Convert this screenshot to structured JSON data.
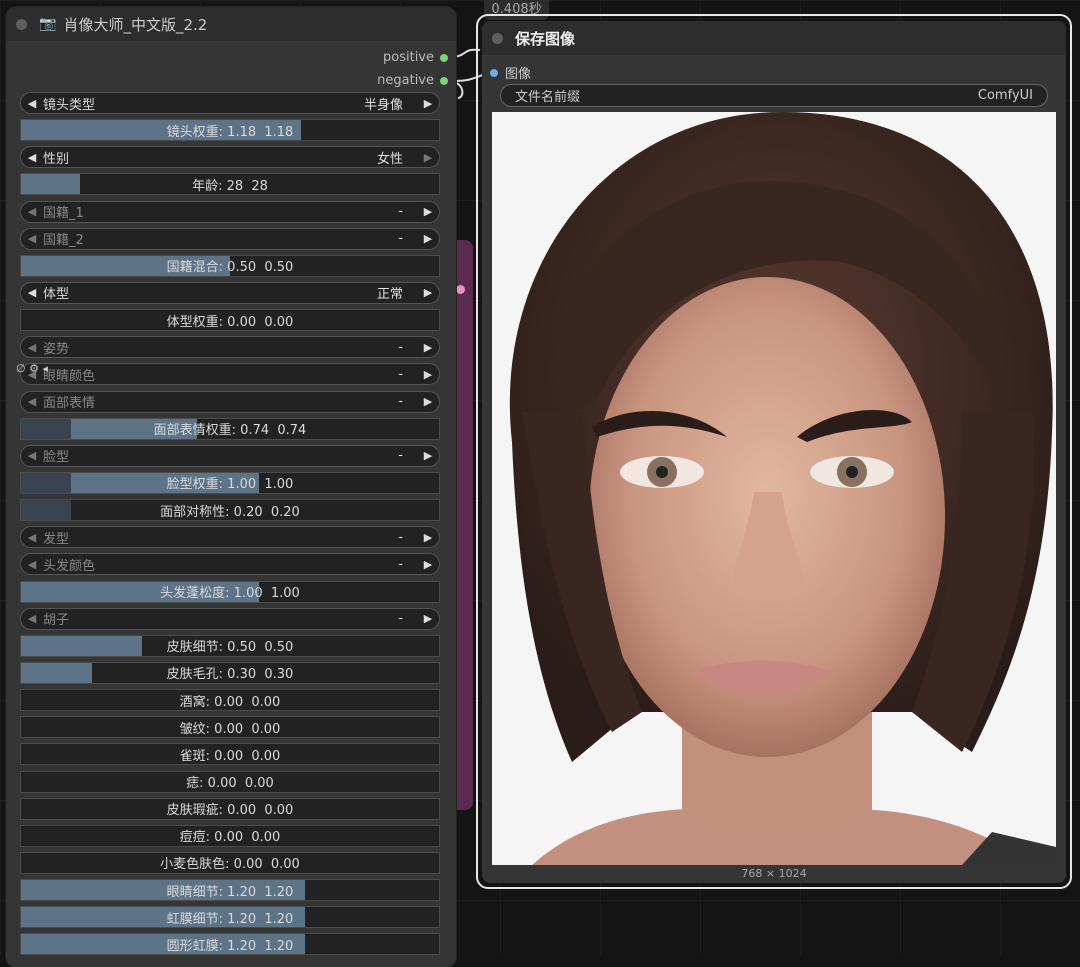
{
  "left_node": {
    "title": "肖像大师_中文版_2.2",
    "outputs": [
      "positive",
      "negative"
    ],
    "widgets": [
      {
        "kind": "combo",
        "label": "镜头类型",
        "value": "半身像",
        "dim": false
      },
      {
        "kind": "slider",
        "text": "镜头权重: 1.18  1.18",
        "fill": 0.67
      },
      {
        "kind": "combo",
        "label": "性别",
        "value": "女性",
        "dim": false,
        "rightDim": true
      },
      {
        "kind": "slider",
        "text": "年龄: 28  28",
        "fill": 0.14
      },
      {
        "kind": "combo",
        "label": "国籍_1",
        "value": "-",
        "dim": true
      },
      {
        "kind": "combo",
        "label": "国籍_2",
        "value": "-",
        "dim": true
      },
      {
        "kind": "slider",
        "text": "国籍混合: 0.50  0.50",
        "fill": 0.5
      },
      {
        "kind": "combo",
        "label": "体型",
        "value": "正常",
        "dim": false
      },
      {
        "kind": "slider",
        "text": "体型权重: 0.00  0.00",
        "fill": 0.0
      },
      {
        "kind": "combo",
        "label": "姿势",
        "value": "-",
        "dim": true
      },
      {
        "kind": "combo",
        "label": "眼睛颜色",
        "value": "-",
        "dim": true
      },
      {
        "kind": "combo",
        "label": "面部表情",
        "value": "-",
        "dim": true
      },
      {
        "kind": "slider",
        "text": "面部表情权重: 0.74  0.74",
        "fill": 0.42,
        "fill2": 0.12
      },
      {
        "kind": "combo",
        "label": "脸型",
        "value": "-",
        "dim": true
      },
      {
        "kind": "slider",
        "text": "脸型权重: 1.00  1.00",
        "fill": 0.57,
        "fill2": 0.12
      },
      {
        "kind": "slider",
        "text": "面部对称性: 0.20  0.20",
        "fill": 0.0,
        "fill2": 0.12
      },
      {
        "kind": "combo",
        "label": "发型",
        "value": "-",
        "dim": true
      },
      {
        "kind": "combo",
        "label": "头发颜色",
        "value": "-",
        "dim": true
      },
      {
        "kind": "slider",
        "text": "头发蓬松度: 1.00  1.00",
        "fill": 0.57
      },
      {
        "kind": "combo",
        "label": "胡子",
        "value": "-",
        "dim": true
      },
      {
        "kind": "slider",
        "text": "皮肤细节: 0.50  0.50",
        "fill": 0.29
      },
      {
        "kind": "slider",
        "text": "皮肤毛孔: 0.30  0.30",
        "fill": 0.17
      },
      {
        "kind": "slider",
        "text": "酒窝: 0.00  0.00",
        "fill": 0.0
      },
      {
        "kind": "slider",
        "text": "皱纹: 0.00  0.00",
        "fill": 0.0
      },
      {
        "kind": "slider",
        "text": "雀斑: 0.00  0.00",
        "fill": 0.0
      },
      {
        "kind": "slider",
        "text": "痣: 0.00  0.00",
        "fill": 0.0
      },
      {
        "kind": "slider",
        "text": "皮肤瑕疵: 0.00  0.00",
        "fill": 0.0
      },
      {
        "kind": "slider",
        "text": "痘痘: 0.00  0.00",
        "fill": 0.0
      },
      {
        "kind": "slider",
        "text": "小麦色肤色: 0.00  0.00",
        "fill": 0.0
      },
      {
        "kind": "slider",
        "text": "眼睛细节: 1.20  1.20",
        "fill": 0.68
      },
      {
        "kind": "slider",
        "text": "虹膜细节: 1.20  1.20",
        "fill": 0.68
      },
      {
        "kind": "slider",
        "text": "圆形虹膜: 1.20  1.20",
        "fill": 0.68
      }
    ]
  },
  "right_node": {
    "timing": "0.408秒",
    "title": "保存图像",
    "input_label": "图像",
    "prefix_label": "文件名前缀",
    "prefix_value": "ComfyUI",
    "image_size": "768 × 1024"
  }
}
